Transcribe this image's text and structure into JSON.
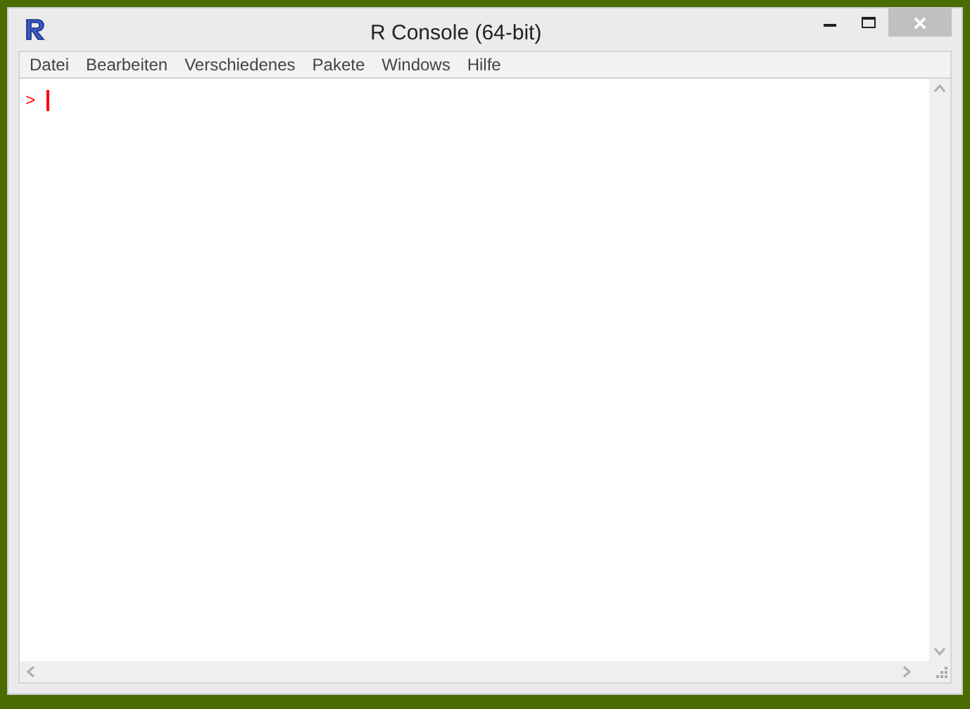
{
  "window": {
    "title": "R Console (64-bit)"
  },
  "menu": [
    {
      "label": "Datei"
    },
    {
      "label": "Bearbeiten"
    },
    {
      "label": "Verschiedenes"
    },
    {
      "label": "Pakete"
    },
    {
      "label": "Windows"
    },
    {
      "label": "Hilfe"
    }
  ],
  "console": {
    "prompt": ">"
  }
}
